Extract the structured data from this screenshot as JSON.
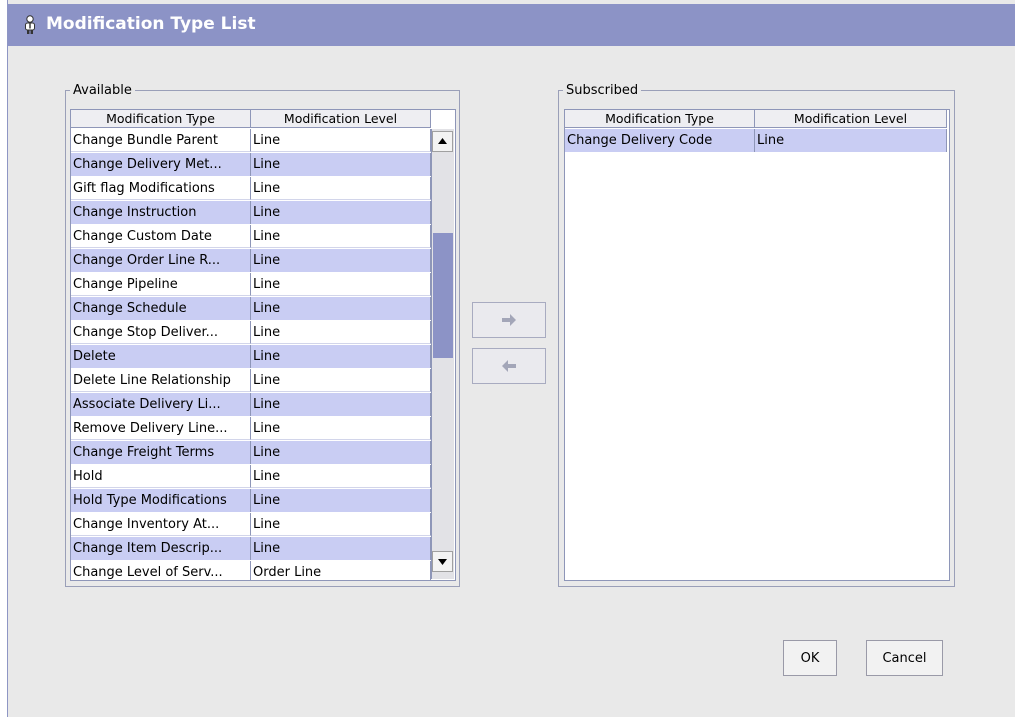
{
  "window": {
    "title": "Modification Type List",
    "title_icon": "person-icon"
  },
  "available": {
    "legend": "Available",
    "columns": [
      "Modification Type",
      "Modification Level"
    ],
    "rows": [
      [
        "Change Bundle Parent",
        "Line"
      ],
      [
        "Change Delivery Met...",
        "Line"
      ],
      [
        "Gift flag Modifications",
        "Line"
      ],
      [
        "Change Instruction",
        "Line"
      ],
      [
        "Change Custom Date",
        "Line"
      ],
      [
        "Change Order Line R...",
        "Line"
      ],
      [
        "Change Pipeline",
        "Line"
      ],
      [
        "Change Schedule",
        "Line"
      ],
      [
        "Change Stop Deliver...",
        "Line"
      ],
      [
        "Delete",
        "Line"
      ],
      [
        "Delete Line Relationship",
        "Line"
      ],
      [
        "Associate Delivery Li...",
        "Line"
      ],
      [
        "Remove Delivery Line...",
        "Line"
      ],
      [
        "Change Freight Terms",
        "Line"
      ],
      [
        "Hold",
        "Line"
      ],
      [
        "Hold Type Modifications",
        "Line"
      ],
      [
        "Change Inventory At...",
        "Line"
      ],
      [
        "Change Item Descrip...",
        "Line"
      ],
      [
        "Change Level of Serv...",
        "Order Line"
      ]
    ]
  },
  "subscribed": {
    "legend": "Subscribed",
    "columns": [
      "Modification Type",
      "Modification Level"
    ],
    "rows": [
      [
        "Change Delivery Code",
        "Line"
      ]
    ]
  },
  "move_buttons": {
    "add_icon": "arrow-right-icon",
    "remove_icon": "arrow-left-icon"
  },
  "buttons": {
    "ok": "OK",
    "cancel": "Cancel"
  },
  "colors": {
    "title_bar": "#8c93c6",
    "row_alt": "#c9cdf3",
    "background": "#e9e9e9"
  }
}
